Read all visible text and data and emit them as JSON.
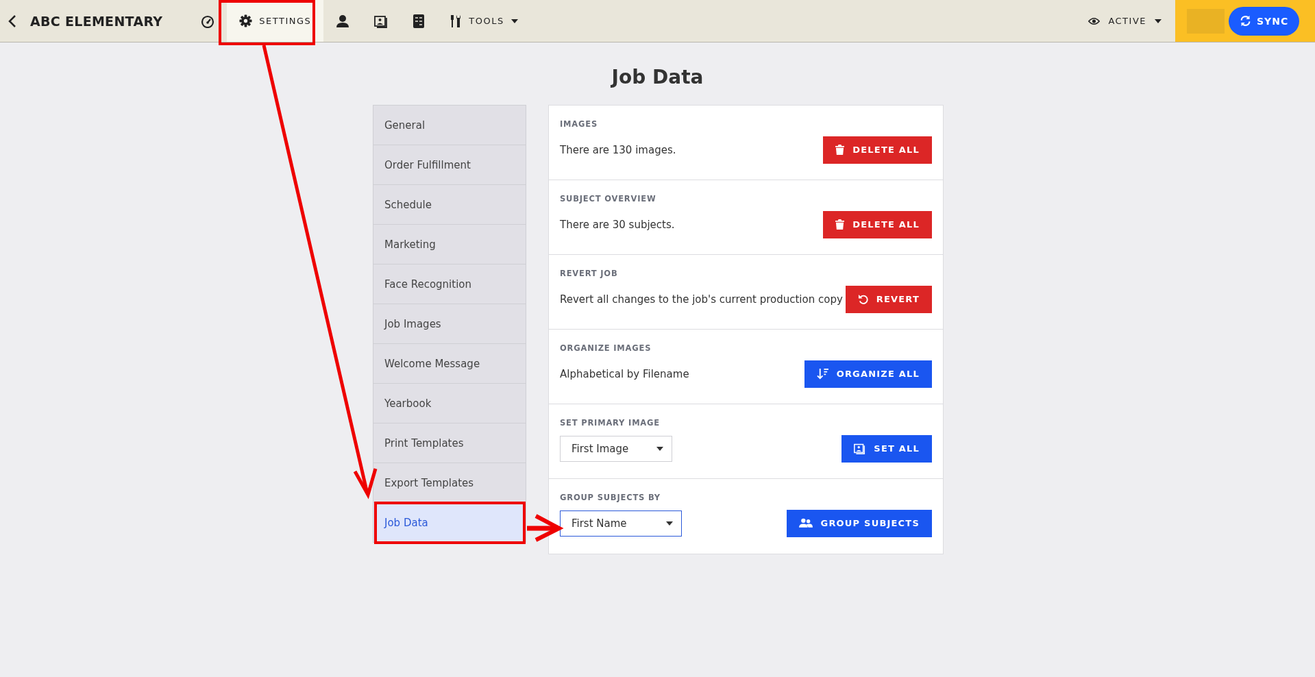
{
  "top_bar": {
    "title": "ABC ELEMENTARY",
    "nav": [
      {
        "kind": "gauge",
        "selected": false
      },
      {
        "kind": "gear",
        "label": "SETTINGS",
        "selected": true
      },
      {
        "kind": "person",
        "selected": false
      },
      {
        "kind": "photos",
        "selected": false
      },
      {
        "kind": "invoice",
        "selected": false
      },
      {
        "kind": "tools",
        "label": "TOOLS",
        "selected": false
      }
    ],
    "status": "ACTIVE",
    "sync_button": "SYNC"
  },
  "page_title": "Job Data",
  "sidebar": {
    "items": [
      {
        "label": "General",
        "selected": false
      },
      {
        "label": "Order Fulfillment",
        "selected": false
      },
      {
        "label": "Schedule",
        "selected": false
      },
      {
        "label": "Marketing",
        "selected": false
      },
      {
        "label": "Face Recognition",
        "selected": false
      },
      {
        "label": "Job Images",
        "selected": false
      },
      {
        "label": "Welcome Message",
        "selected": false
      },
      {
        "label": "Yearbook",
        "selected": false
      },
      {
        "label": "Print Templates",
        "selected": false
      },
      {
        "label": "Export Templates",
        "selected": false
      },
      {
        "label": "Job Data",
        "selected": true
      }
    ]
  },
  "sections": [
    {
      "heading": "IMAGES",
      "kind": "text",
      "text": "There are 130 images.",
      "button": {
        "label": "DELETE ALL",
        "kind": "danger"
      }
    },
    {
      "heading": "SUBJECT OVERVIEW",
      "kind": "text",
      "text": "There are 30 subjects.",
      "button": {
        "label": "DELETE ALL",
        "kind": "danger"
      }
    },
    {
      "heading": "REVERT JOB",
      "kind": "text",
      "text": "Revert all changes to the job's current production copy",
      "button": {
        "label": "REVERT",
        "kind": "danger"
      }
    },
    {
      "heading": "ORGANIZE IMAGES",
      "kind": "text",
      "text": "Alphabetical by Filename",
      "button": {
        "label": "ORGANIZE ALL",
        "kind": "primary"
      }
    },
    {
      "heading": "SET PRIMARY IMAGE",
      "kind": "select",
      "text": "First Image",
      "focused": false,
      "button": {
        "label": "SET ALL",
        "kind": "primary"
      }
    },
    {
      "heading": "GROUP SUBJECTS BY",
      "kind": "select",
      "text": "First Name",
      "focused": true,
      "button": {
        "label": "GROUP SUBJECTS",
        "kind": "primary"
      }
    }
  ]
}
